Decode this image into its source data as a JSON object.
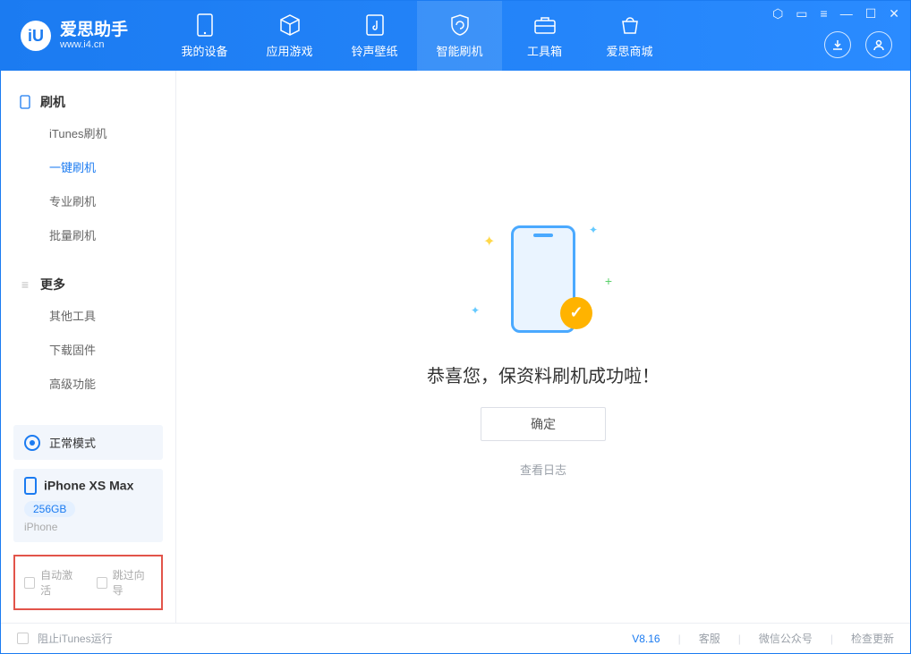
{
  "brand": {
    "title": "爱思助手",
    "subtitle": "www.i4.cn",
    "logo_letter": "iU"
  },
  "tabs": [
    {
      "label": "我的设备"
    },
    {
      "label": "应用游戏"
    },
    {
      "label": "铃声壁纸"
    },
    {
      "label": "智能刷机"
    },
    {
      "label": "工具箱"
    },
    {
      "label": "爱思商城"
    }
  ],
  "sidebar": {
    "group1": {
      "title": "刷机",
      "items": [
        "iTunes刷机",
        "一键刷机",
        "专业刷机",
        "批量刷机"
      ],
      "active_index": 1
    },
    "group2": {
      "title": "更多",
      "items": [
        "其他工具",
        "下载固件",
        "高级功能"
      ]
    }
  },
  "device": {
    "mode": "正常模式",
    "name": "iPhone XS Max",
    "storage": "256GB",
    "type": "iPhone"
  },
  "options": {
    "auto_activate": "自动激活",
    "skip_guide": "跳过向导"
  },
  "main": {
    "success_text": "恭喜您，保资料刷机成功啦！",
    "ok": "确定",
    "view_log": "查看日志"
  },
  "footer": {
    "block_itunes": "阻止iTunes运行",
    "version": "V8.16",
    "links": [
      "客服",
      "微信公众号",
      "检查更新"
    ]
  },
  "colors": {
    "primary": "#1b7bf1",
    "highlight_border": "#e2544a",
    "accent_yellow": "#ffb300"
  }
}
